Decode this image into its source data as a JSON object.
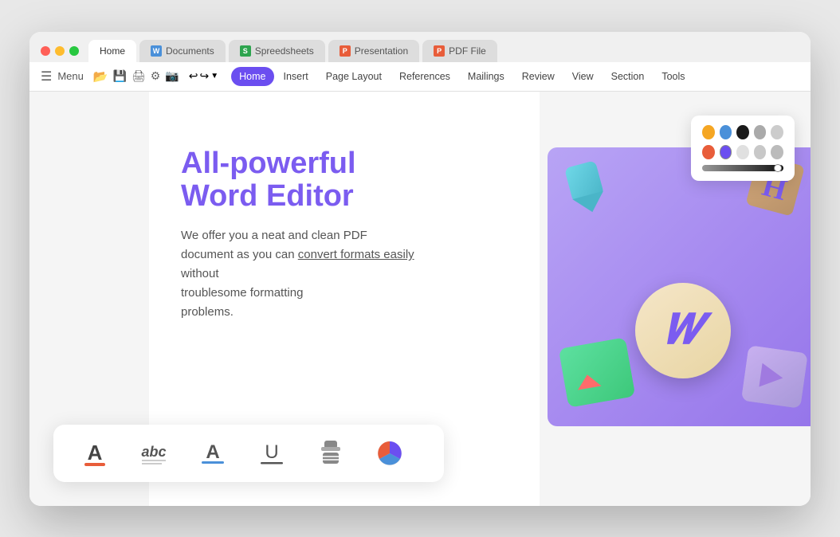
{
  "window": {
    "tabs": [
      {
        "id": "home",
        "label": "Home",
        "active": true,
        "icon": null
      },
      {
        "id": "documents",
        "label": "Documents",
        "active": false,
        "icon": "blue",
        "icon_letter": "W"
      },
      {
        "id": "spreadsheets",
        "label": "Spreedsheets",
        "active": false,
        "icon": "green",
        "icon_letter": "S"
      },
      {
        "id": "presentation",
        "label": "Presentation",
        "active": false,
        "icon": "red-p",
        "icon_letter": "P"
      },
      {
        "id": "pdf-file",
        "label": "PDF File",
        "active": false,
        "icon": "red-pdf",
        "icon_letter": "P"
      }
    ]
  },
  "toolbar": {
    "menu_label": "Menu",
    "undo_symbol": "↩",
    "redo_symbol": "↪"
  },
  "menu_bar": {
    "items": [
      {
        "id": "home",
        "label": "Home",
        "active": true
      },
      {
        "id": "insert",
        "label": "Insert",
        "active": false
      },
      {
        "id": "page-layout",
        "label": "Page Layout",
        "active": false
      },
      {
        "id": "references",
        "label": "References",
        "active": false
      },
      {
        "id": "mailings",
        "label": "Mailings",
        "active": false
      },
      {
        "id": "review",
        "label": "Review",
        "active": false
      },
      {
        "id": "view",
        "label": "View",
        "active": false
      },
      {
        "id": "section",
        "label": "Section",
        "active": false
      },
      {
        "id": "tools",
        "label": "Tools",
        "active": false
      }
    ]
  },
  "document": {
    "title_line1": "All-powerful",
    "title_line2": "Word Editor",
    "body_text": "We offer you a neat and clean PDF document as you can",
    "body_link": "convert formats easily",
    "body_text2": "without troublesome formatting problems."
  },
  "color_picker": {
    "row1": [
      {
        "color": "#f5a623",
        "id": "yellow"
      },
      {
        "color": "#4a90d9",
        "id": "blue"
      },
      {
        "color": "#1a1a1a",
        "id": "black"
      },
      {
        "color": "#aaaaaa",
        "id": "gray1"
      },
      {
        "color": "#cccccc",
        "id": "gray2"
      }
    ],
    "row2": [
      {
        "color": "#e85d3a",
        "id": "red"
      },
      {
        "color": "#6b4ef0",
        "id": "purple",
        "selected": true
      },
      {
        "color": "#e0e0e0",
        "id": "light-gray1"
      },
      {
        "color": "#c8c8c8",
        "id": "light-gray2"
      },
      {
        "color": "#bbbbbb",
        "id": "light-gray3"
      }
    ],
    "slider_label": "brightness-slider"
  },
  "bottom_toolbar": {
    "tools": [
      {
        "id": "font-color",
        "label": "Font Color",
        "symbol": "A",
        "underline_color": "#e85d3a"
      },
      {
        "id": "text-highlight",
        "label": "Text Highlight",
        "symbol": "abc"
      },
      {
        "id": "font-underline",
        "label": "Font Underline A",
        "symbol": "A"
      },
      {
        "id": "underline",
        "label": "Underline",
        "symbol": "U"
      },
      {
        "id": "stamp",
        "label": "Stamp/Eraser",
        "symbol": "⛃"
      },
      {
        "id": "pie-chart",
        "label": "Pie Chart",
        "symbol": "◔"
      }
    ]
  }
}
